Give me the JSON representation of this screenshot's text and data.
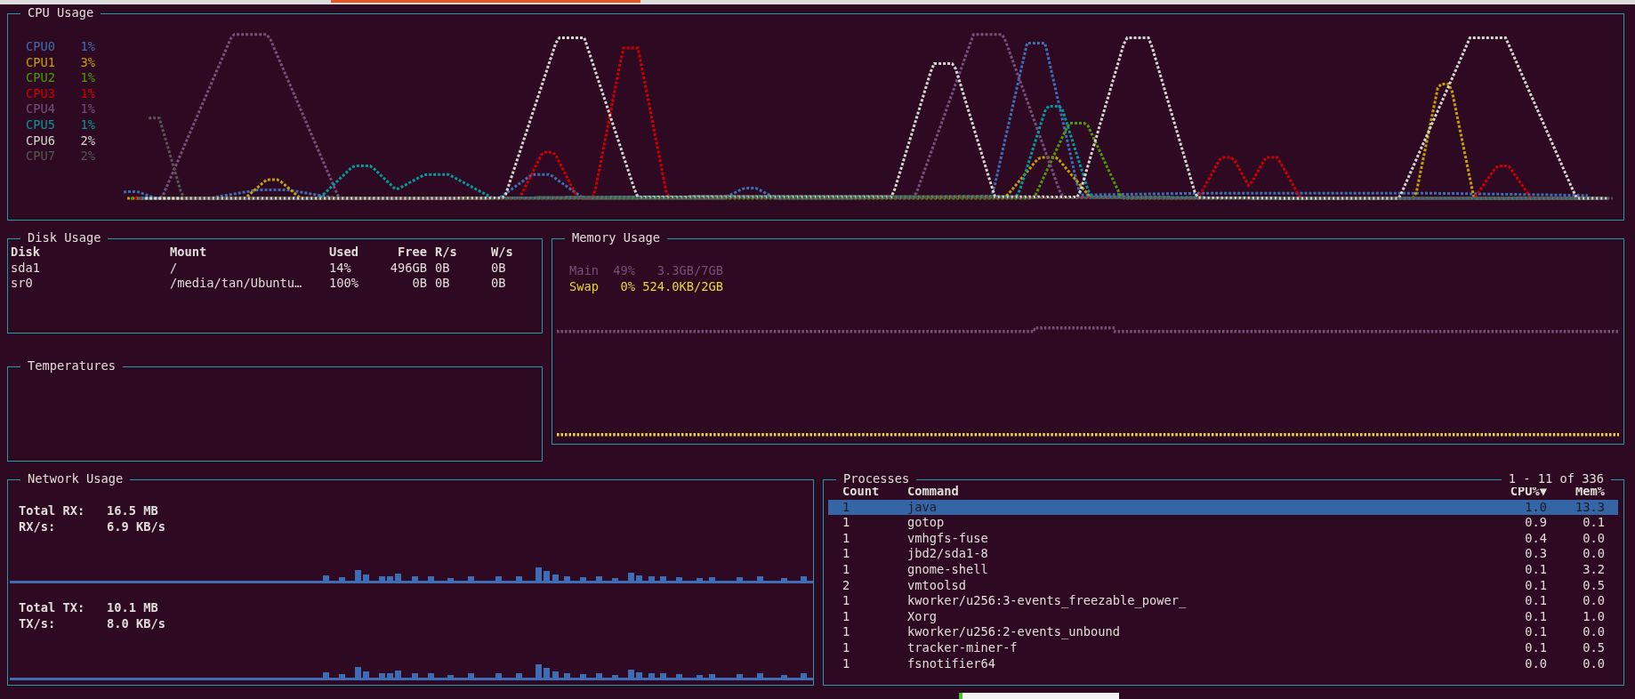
{
  "cpu_usage": {
    "title": "CPU Usage",
    "legend": [
      {
        "name": "CPU0",
        "value": "1%",
        "color": "#3e6db5"
      },
      {
        "name": "CPU1",
        "value": "3%",
        "color": "#c4a000"
      },
      {
        "name": "CPU2",
        "value": "1%",
        "color": "#4e9a06"
      },
      {
        "name": "CPU3",
        "value": "1%",
        "color": "#cc0000"
      },
      {
        "name": "CPU4",
        "value": "1%",
        "color": "#75507b"
      },
      {
        "name": "CPU5",
        "value": "1%",
        "color": "#06989a"
      },
      {
        "name": "CPU6",
        "value": "2%",
        "color": "#d3d7cf"
      },
      {
        "name": "CPU7",
        "value": "2%",
        "color": "#555753"
      }
    ]
  },
  "disk_usage": {
    "title": "Disk Usage",
    "columns": [
      "Disk",
      "Mount",
      "Used",
      "Free",
      "R/s",
      "W/s"
    ],
    "rows": [
      [
        "sda1",
        "/",
        "14%",
        "496GB",
        "0B",
        "0B"
      ],
      [
        "sr0",
        "/media/tan/Ubuntu…",
        "100%",
        "0B",
        "0B",
        "0B"
      ]
    ]
  },
  "temperatures": {
    "title": "Temperatures"
  },
  "memory_usage": {
    "title": "Memory Usage",
    "legend": [
      {
        "name": "Main",
        "percent": "49%",
        "amount": "3.3GB/7GB",
        "color": "#75507b"
      },
      {
        "name": "Swap",
        "percent": "0%",
        "amount": "524.0KB/2GB",
        "color": "#e8d43a"
      }
    ]
  },
  "network_usage": {
    "title": "Network Usage",
    "sections": [
      {
        "total_label": "Total RX:",
        "total": "16.5 MB",
        "rate_label": "RX/s:",
        "rate": "6.9 KB/s"
      },
      {
        "total_label": "Total TX:",
        "total": "10.1 MB",
        "rate_label": "TX/s:",
        "rate": "8.0 KB/s"
      }
    ]
  },
  "processes": {
    "title": "Processes",
    "range": "1 - 11 of 336",
    "columns": [
      "Count",
      "Command",
      "CPU%▼",
      "Mem%"
    ],
    "rows": [
      {
        "cells": [
          "1",
          "java",
          "1.0",
          "13.3"
        ],
        "selected": true
      },
      {
        "cells": [
          "1",
          "gotop",
          "0.9",
          "0.1"
        ],
        "selected": false
      },
      {
        "cells": [
          "1",
          "vmhgfs-fuse",
          "0.4",
          "0.0"
        ],
        "selected": false
      },
      {
        "cells": [
          "1",
          "jbd2/sda1-8",
          "0.3",
          "0.0"
        ],
        "selected": false
      },
      {
        "cells": [
          "1",
          "gnome-shell",
          "0.1",
          "3.2"
        ],
        "selected": false
      },
      {
        "cells": [
          "2",
          "vmtoolsd",
          "0.1",
          "0.5"
        ],
        "selected": false
      },
      {
        "cells": [
          "1",
          "kworker/u256:3-events_freezable_power_",
          "0.1",
          "0.0"
        ],
        "selected": false
      },
      {
        "cells": [
          "1",
          "Xorg",
          "0.1",
          "1.0"
        ],
        "selected": false
      },
      {
        "cells": [
          "1",
          "kworker/u256:2-events_unbound",
          "0.1",
          "0.0"
        ],
        "selected": false
      },
      {
        "cells": [
          "1",
          "tracker-miner-f",
          "0.1",
          "0.5"
        ],
        "selected": false
      },
      {
        "cells": [
          "1",
          "fsnotifier64",
          "0.0",
          "0.0"
        ],
        "selected": false
      }
    ]
  }
}
